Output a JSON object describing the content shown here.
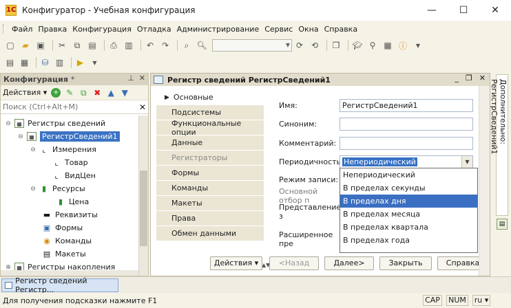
{
  "window": {
    "title": "Конфигуратор - Учебная конфигурация",
    "minimize": "—",
    "maximize": "☐",
    "close": "✕"
  },
  "menu": [
    "Файл",
    "Правка",
    "Конфигурация",
    "Отладка",
    "Администрирование",
    "Сервис",
    "Окна",
    "Справка"
  ],
  "left_panel": {
    "title": "Конфигурация",
    "title_mark": "*",
    "actions_label": "Действия",
    "search_placeholder": "Поиск (Ctrl+Alt+M)",
    "tree": [
      {
        "label": "Регистры сведений",
        "icon": "register-icon"
      },
      {
        "label": "РегистрСведений1",
        "icon": "register-icon",
        "selected": true
      },
      {
        "label": "Измерения",
        "icon": "dimension-icon"
      },
      {
        "label": "Товар",
        "icon": "dimension-icon"
      },
      {
        "label": "ВидЦен",
        "icon": "dimension-icon"
      },
      {
        "label": "Ресурсы",
        "icon": "resource-icon"
      },
      {
        "label": "Цена",
        "icon": "resource-icon"
      },
      {
        "label": "Реквизиты",
        "icon": "attribute-icon"
      },
      {
        "label": "Формы",
        "icon": "form-icon"
      },
      {
        "label": "Команды",
        "icon": "command-icon"
      },
      {
        "label": "Макеты",
        "icon": "template-icon"
      },
      {
        "label": "Регистры накопления",
        "icon": "register-icon"
      }
    ]
  },
  "editor": {
    "title": "Регистр сведений РегистрСведений1",
    "tabs": [
      {
        "label": "Основные",
        "active": true
      },
      {
        "label": "Подсистемы"
      },
      {
        "label": "Функциональные опции"
      },
      {
        "label": "Данные"
      },
      {
        "label": "Регистраторы",
        "disabled": true
      },
      {
        "label": "Формы"
      },
      {
        "label": "Команды"
      },
      {
        "label": "Макеты"
      },
      {
        "label": "Права"
      },
      {
        "label": "Обмен данными"
      }
    ],
    "fields": {
      "name_label": "Имя:",
      "name_value": "РегистрСведений1",
      "synonym_label": "Синоним:",
      "synonym_value": "",
      "comment_label": "Комментарий:",
      "comment_value": "",
      "periodicity_label": "Периодичность:",
      "periodicity_value": "Непериодический",
      "write_mode_label": "Режим записи:",
      "main_filter_label": "Основной отбор п",
      "presentation_label": "Представление з",
      "extended_label": "Расширенное пре"
    },
    "periodicity_options": [
      "Непериодический",
      "В пределах секунды",
      "В пределах дня",
      "В пределах месяца",
      "В пределах квартала",
      "В пределах года"
    ],
    "highlighted_option": "В пределах дня",
    "buttons": {
      "actions": "Действия",
      "back": "<Назад",
      "next": "Далее>",
      "close": "Закрыть",
      "help": "Справка"
    }
  },
  "right_panel": {
    "tab_label": "Дополнительно: РегистрСведений1"
  },
  "taskbar": {
    "tab_label": "Регистр сведений Регистр..."
  },
  "status": {
    "hint": "Для получения подсказки нажмите F1",
    "cap": "CAP",
    "num": "NUM",
    "lang": "ru"
  }
}
